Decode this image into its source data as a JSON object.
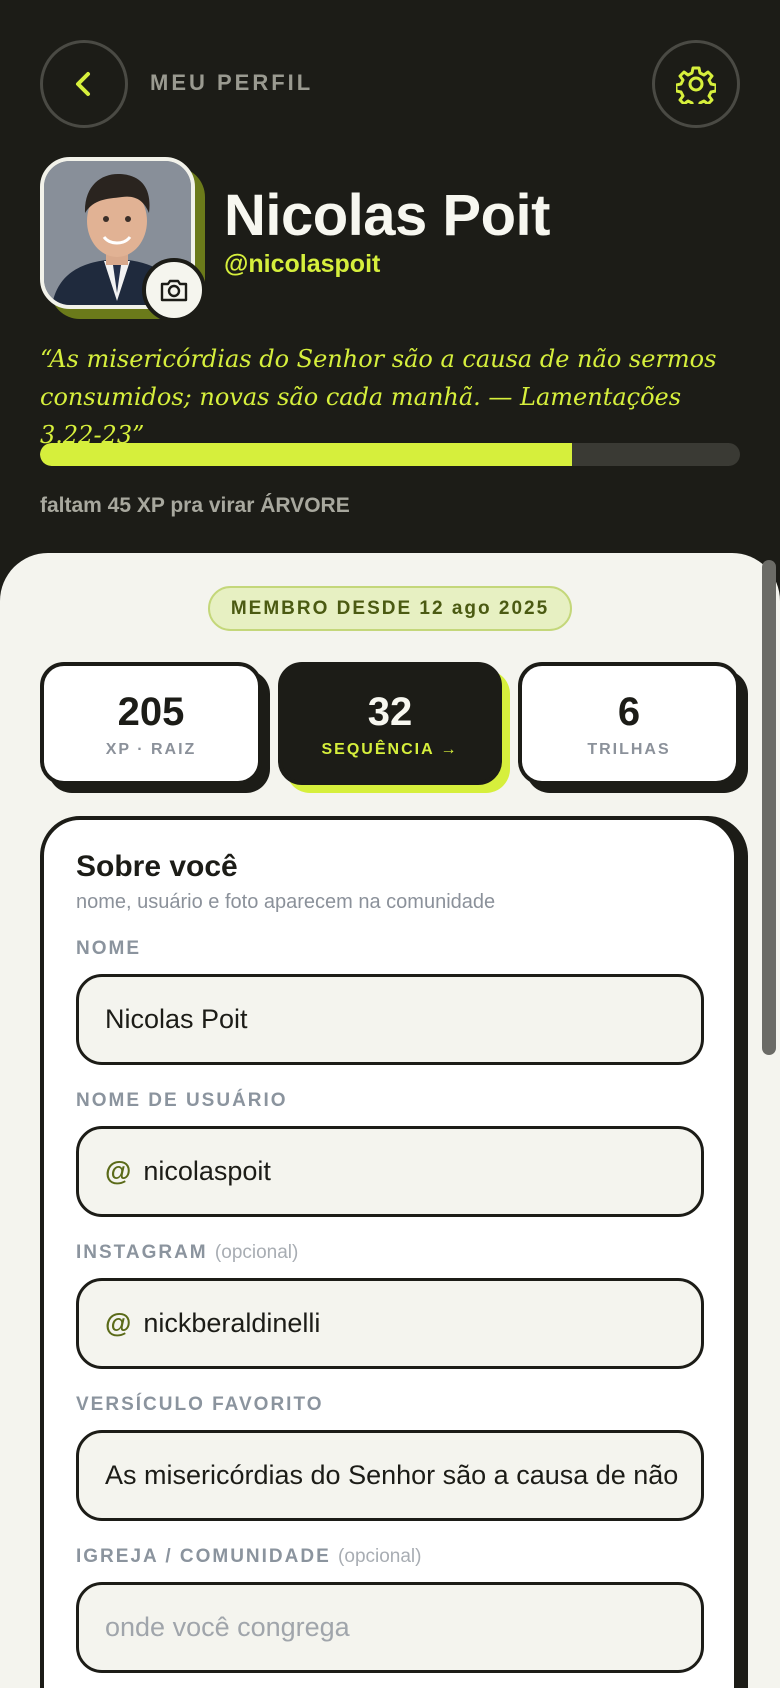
{
  "header": {
    "page_title": "MEU PERFIL",
    "back_icon": "chevron-left-icon",
    "settings_icon": "gear-icon",
    "accent": "#d6ef3c"
  },
  "profile": {
    "name": "Nicolas Poit",
    "handle": "@nicolaspoit",
    "quote": "“As misericórdias do Senhor são a causa de não sermos consumidos; novas são cada manhã. — Lamentações 3.22-23”",
    "camera_icon": "camera-icon"
  },
  "progress": {
    "xp_fraction": 0.76,
    "text": "faltam 45 XP pra virar ÁRVORE"
  },
  "member_since": "MEMBRO DESDE 12 ago 2025",
  "stats": [
    {
      "value": "205",
      "label": "XP · RAIZ"
    },
    {
      "value": "32",
      "label": "SEQUÊNCIA →"
    },
    {
      "value": "6",
      "label": "TRILHAS"
    }
  ],
  "about": {
    "title": "Sobre você",
    "subtitle": "nome, usuário e foto aparecem na comunidade",
    "fields": [
      {
        "label": "NOME",
        "optional": "",
        "prefix": "",
        "value": "Nicolas Poit",
        "placeholder": ""
      },
      {
        "label": "NOME DE USUÁRIO",
        "optional": "",
        "prefix": "@",
        "value": "nicolaspoit",
        "placeholder": ""
      },
      {
        "label": "INSTAGRAM",
        "optional": "(opcional)",
        "prefix": "@",
        "value": "nickberaldinelli",
        "placeholder": ""
      },
      {
        "label": "VERSÍCULO FAVORITO",
        "optional": "",
        "prefix": "",
        "value": "As misericórdias do Senhor são a causa de não",
        "placeholder": ""
      },
      {
        "label": "IGREJA / COMUNIDADE",
        "optional": "(opcional)",
        "prefix": "",
        "value": "",
        "placeholder": "onde você congrega"
      }
    ]
  }
}
